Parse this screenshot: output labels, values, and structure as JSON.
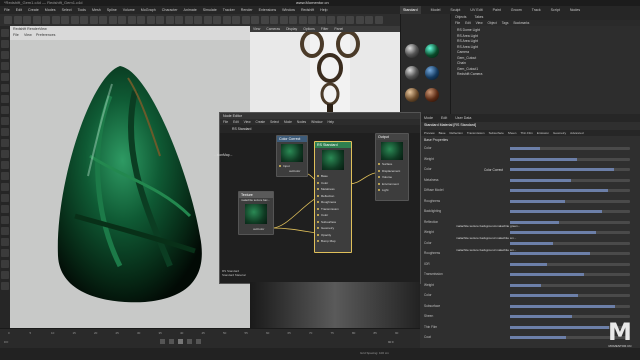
{
  "window": {
    "title_left": "*Redshift_Gem1.c4d — Redshift_Gem1.c4d",
    "title_center": "www.Momentor.cn"
  },
  "menubar": {
    "items": [
      "File",
      "Edit",
      "Create",
      "Modes",
      "Select",
      "Tools",
      "Mesh",
      "Spline",
      "Volume",
      "MoGraph",
      "Character",
      "Animate",
      "Simulate",
      "Tracker",
      "Render",
      "Extensions",
      "Window",
      "Redshift",
      "Help"
    ]
  },
  "layout_tabs": {
    "items": [
      "Standard",
      "Model",
      "Sculpt",
      "UV Edit",
      "Paint",
      "Groom",
      "Track",
      "Script",
      "Nodes"
    ],
    "active": "Standard"
  },
  "viewport1": {
    "label": "Redshift RenderView",
    "menu": [
      "File",
      "View",
      "Preferences"
    ]
  },
  "viewport2": {
    "menu": [
      "View",
      "Cameras",
      "Display",
      "Options",
      "Filter",
      "Panel"
    ]
  },
  "objects_panel": {
    "tabs": [
      "Objects",
      "Takes"
    ],
    "menu": [
      "File",
      "Edit",
      "View",
      "Object",
      "Tags",
      "Bookmarks"
    ],
    "rows": [
      "RS Dome Light",
      "RS Area Light",
      "RS Area Light",
      "RS Area Light",
      "Camera",
      "Gem_Cutout",
      "Chain",
      "Gem_Cutout1",
      "Redshift Camera"
    ]
  },
  "node_editor": {
    "title": "Node Editor",
    "menu": [
      "File",
      "Edit",
      "View",
      "Create",
      "Select",
      "Mode",
      "Nodes",
      "Window",
      "Help"
    ],
    "breadcrumb": "RS Standard",
    "nodes": {
      "color_correct": {
        "title": "Color Correct",
        "port_in": "Input",
        "port_out": "outColor"
      },
      "texture": {
        "title": "Texture",
        "subtitle": "malachite texture bac...",
        "port_out": "outColor"
      },
      "rs_standard": {
        "title": "RS Standard",
        "subtitle": "Standard Material",
        "ports": [
          "Base",
          "Color",
          "Metalness",
          "Reflection",
          "Roughness",
          "Transmission",
          "Color",
          "Subsurface",
          "Geometry",
          "Opacity",
          "Bump Map"
        ]
      },
      "output": {
        "title": "Output",
        "ports": [
          "Surface",
          "Displacement",
          "Volume",
          "Environment",
          "Light"
        ]
      },
      "fragment": {
        "title": "...sionMap..."
      }
    },
    "bottom_info": "RS Standard\nStandard Material"
  },
  "attributes_panel": {
    "tabs": [
      "Mode",
      "Edit",
      "User Data"
    ],
    "title": "Standard Material [RS Standard]",
    "subtabs": [
      "Preview",
      "Base",
      "Reflection",
      "Transmission",
      "Subsurface",
      "Sheen",
      "Thin Film",
      "Emission",
      "Geometry",
      "Advanced"
    ],
    "section": "Base Properties",
    "rows": [
      "Color",
      "Weight",
      "Color",
      "Metalness",
      "Diffuse Model",
      "Roughness",
      "Backlighting",
      "Reflection",
      "Weight",
      "Color",
      "Roughness",
      "IOR",
      "Transmission",
      "Weight",
      "Color",
      "Subsurface",
      "Sheen",
      "Thin Film",
      "Coat"
    ],
    "link_label": "Color Correct",
    "texture_paths": [
      "malachite texture background-malachite green...",
      "malachite texture background malachite sm...",
      "malachite texture background malachite sm..."
    ]
  },
  "timeline": {
    "ticks": [
      "0",
      "5",
      "10",
      "15",
      "20",
      "25",
      "30",
      "35",
      "40",
      "45",
      "50",
      "55",
      "60",
      "65",
      "70",
      "75",
      "80",
      "85",
      "90"
    ],
    "start": "0 F",
    "end": "90 F"
  },
  "status": {
    "left": "Grid Spacing: 100 cm"
  },
  "watermark": {
    "letter": "M",
    "text": "MOMENTOR.CN"
  }
}
